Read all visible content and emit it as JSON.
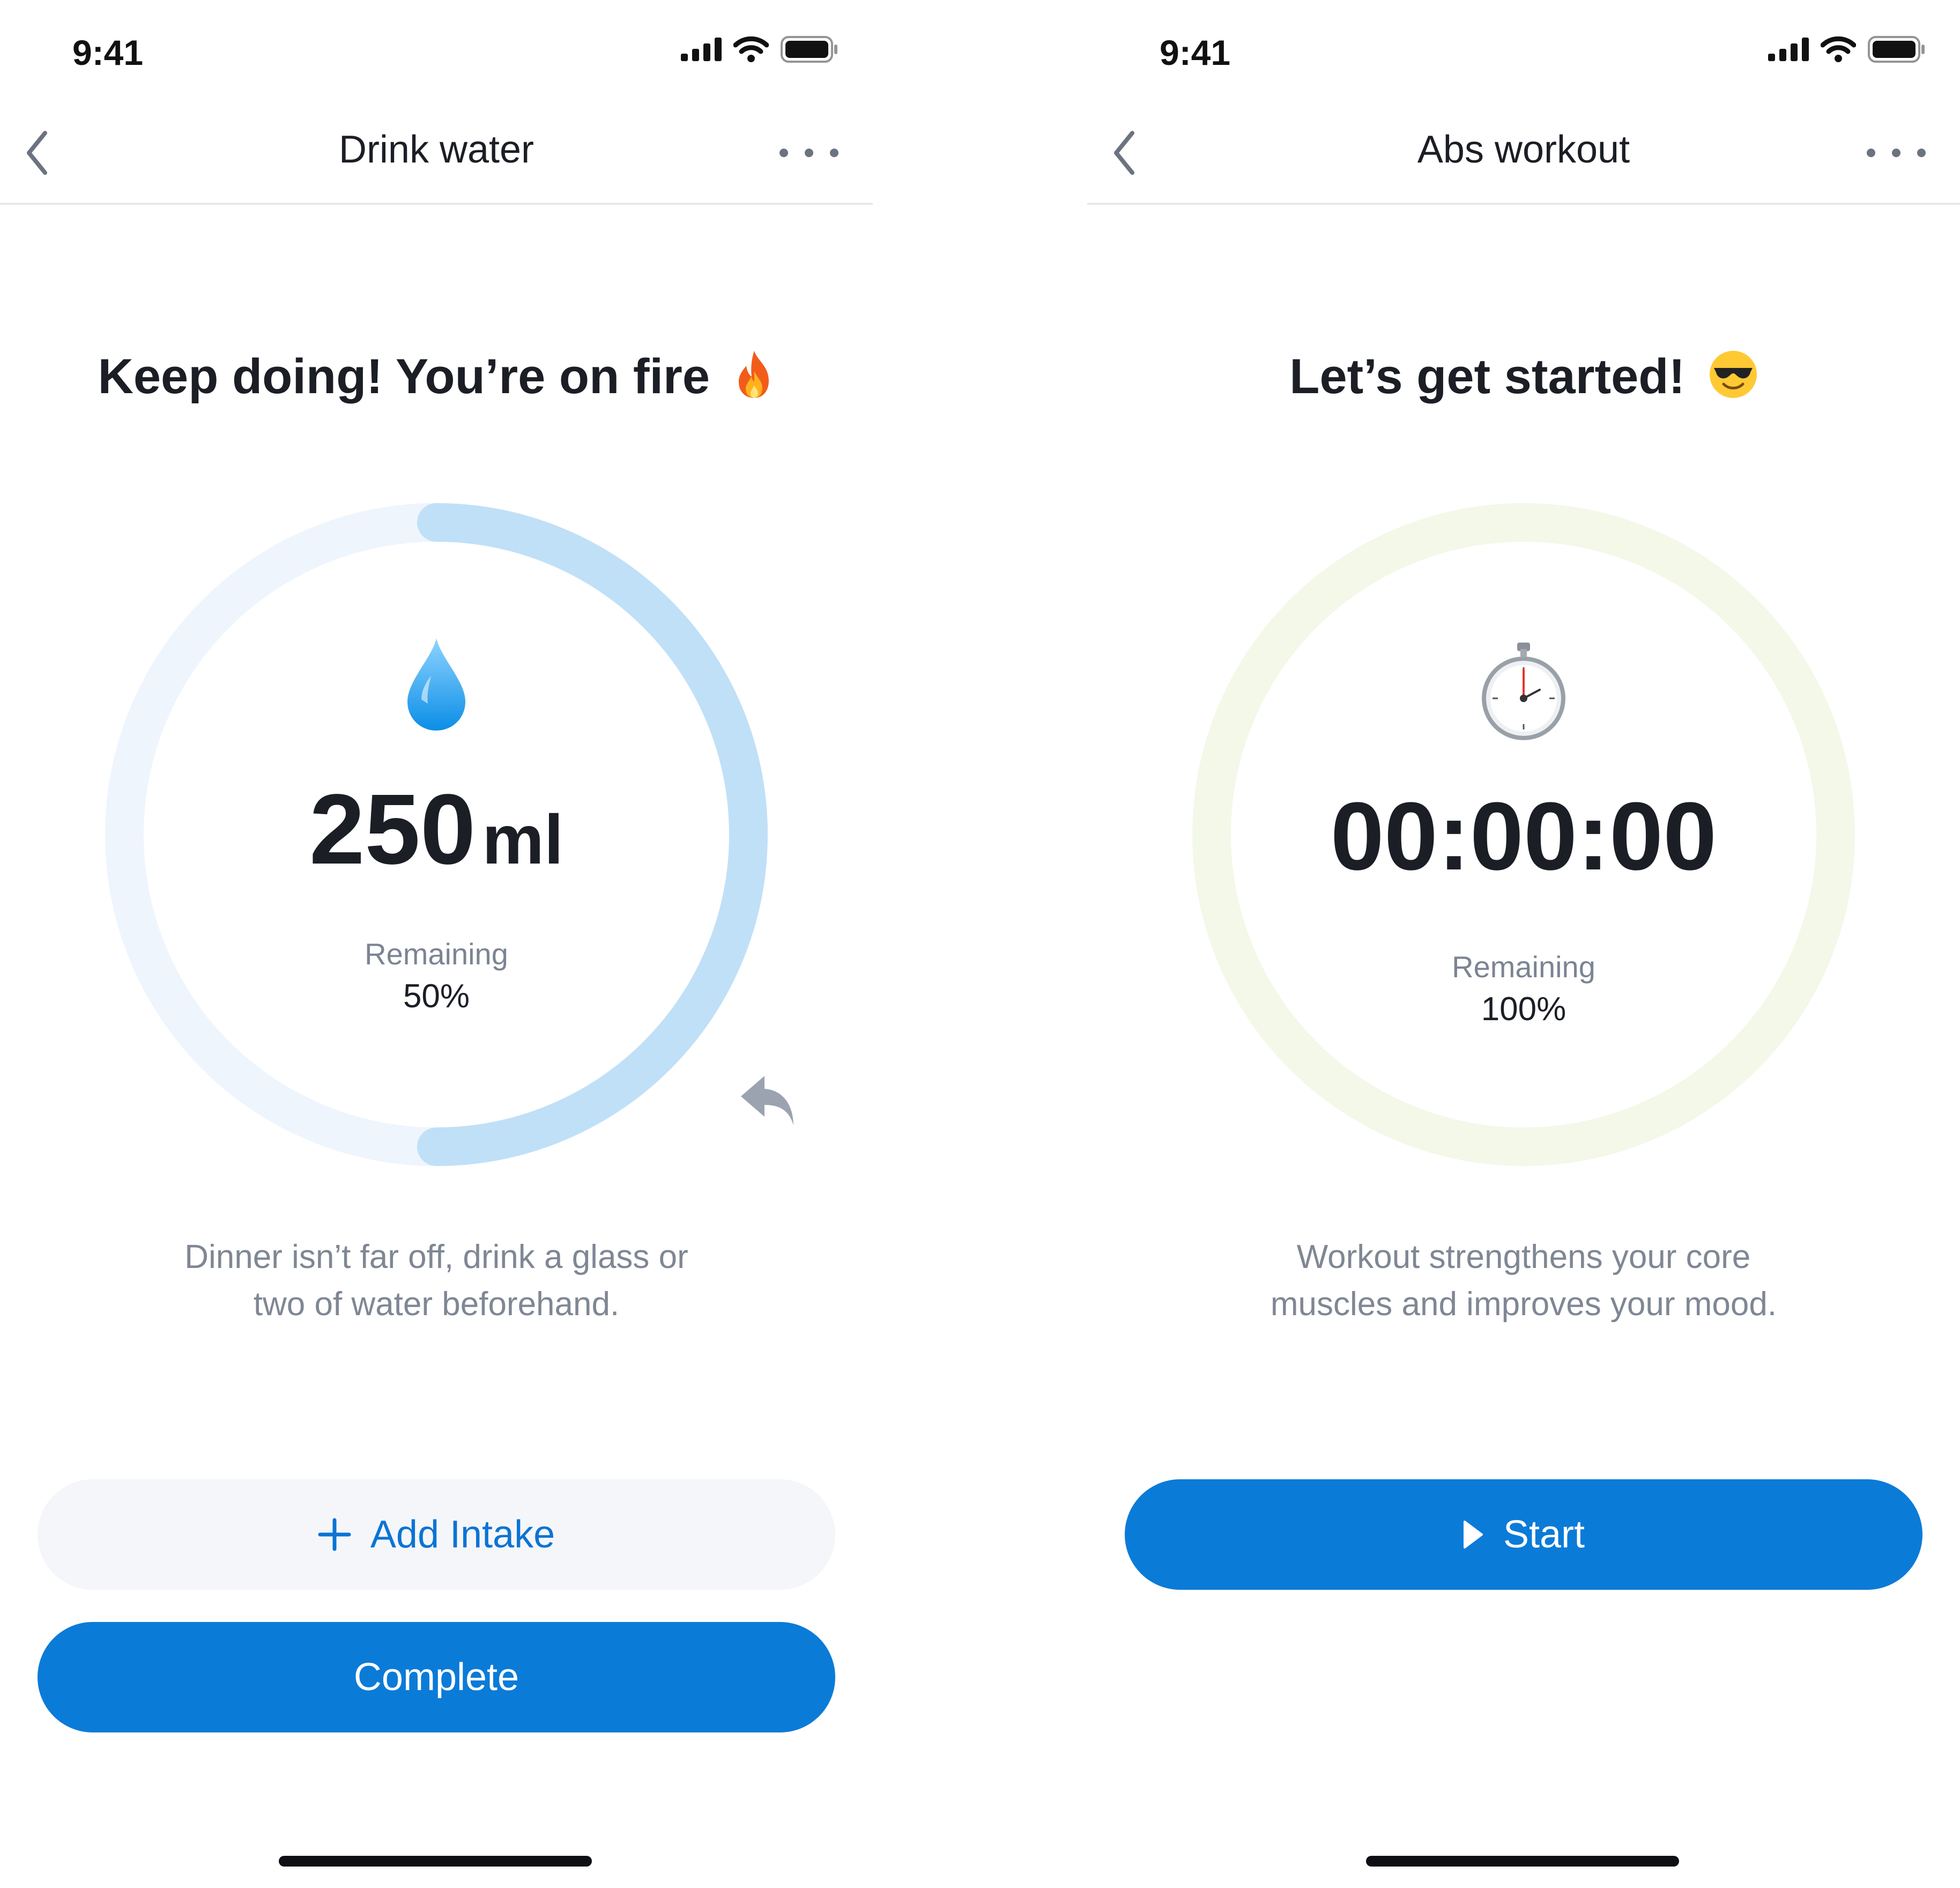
{
  "colors": {
    "accent": "#0b7bd8",
    "water_ring_track": "#eef5fd",
    "water_ring_progress": "#c0e0f7",
    "workout_ring_track": "#f3f8e9",
    "text_primary": "#1c1e26",
    "text_secondary": "#7f8794"
  },
  "screens": [
    {
      "status_bar": {
        "time": "9:41",
        "icons": [
          "cellular-signal-icon",
          "wifi-icon",
          "battery-icon"
        ]
      },
      "nav": {
        "back_icon": "chevron-left-icon",
        "title": "Drink water",
        "more_icon": "ellipsis-icon"
      },
      "headline": "Keep doing! You’re on fire",
      "headline_emoji": "fire-emoji",
      "progress_ring": {
        "completed_fraction": 0.5,
        "center_icon": "water-drop-icon"
      },
      "value": "250",
      "unit": "ml",
      "remaining_label": "Remaining",
      "remaining_value": "50%",
      "undo_icon": "undo-arrow-icon",
      "description": [
        "Dinner isn’t far off, drink a glass or",
        "two of water beforehand."
      ],
      "secondary_button": {
        "icon": "plus-icon",
        "label": "Add Intake"
      },
      "primary_button": {
        "label": "Complete"
      }
    },
    {
      "status_bar": {
        "time": "9:41",
        "icons": [
          "cellular-signal-icon",
          "wifi-icon",
          "battery-icon"
        ]
      },
      "nav": {
        "back_icon": "chevron-left-icon",
        "title": "Abs workout",
        "more_icon": "ellipsis-icon"
      },
      "headline": "Let’s get started!",
      "headline_emoji": "sunglasses-smiley-emoji",
      "progress_ring": {
        "completed_fraction": 0,
        "center_icon": "stopwatch-icon"
      },
      "timer": "00:00:00",
      "remaining_label": "Remaining",
      "remaining_value": "100%",
      "description": [
        "Workout strengthens your core",
        "muscles and improves your mood."
      ],
      "primary_button": {
        "icon": "play-icon",
        "label": "Start"
      }
    }
  ]
}
